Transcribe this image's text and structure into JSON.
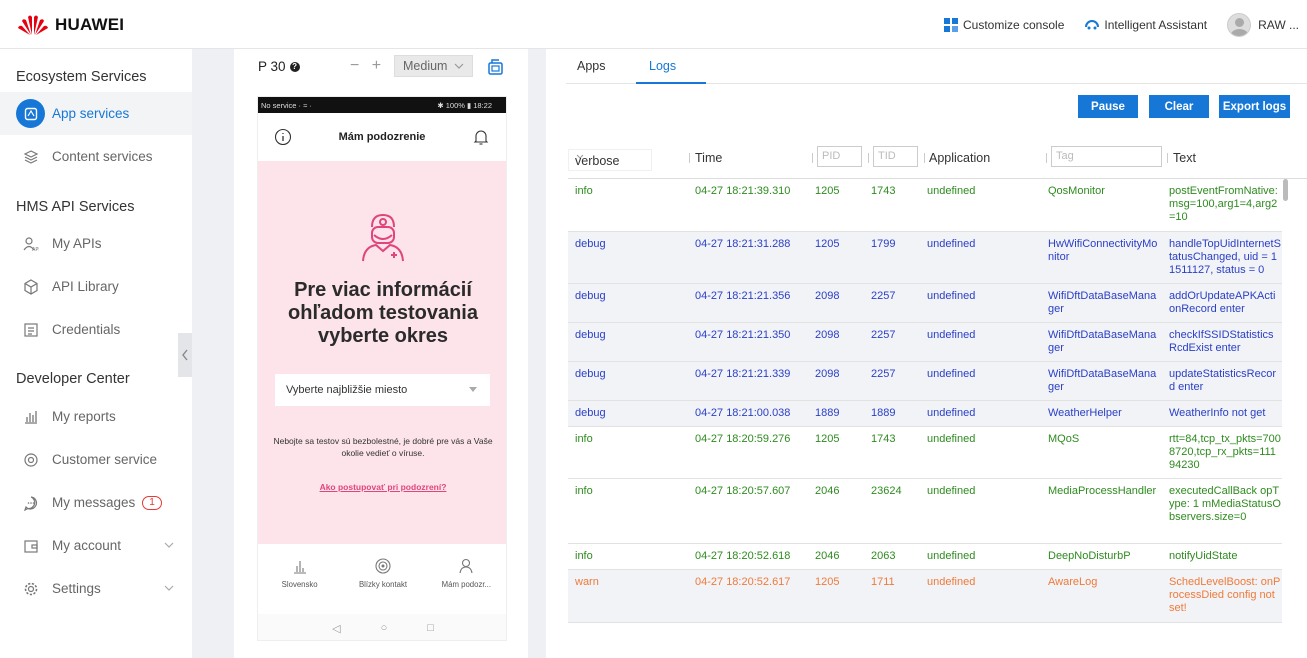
{
  "header": {
    "brand": "HUAWEI",
    "customize_console": "Customize console",
    "intelligent_assistant": "Intelligent Assistant",
    "user_name": "RAW ..."
  },
  "sidebar": {
    "sections": [
      {
        "title": "Ecosystem Services"
      },
      {
        "title": "HMS API Services"
      },
      {
        "title": "Developer Center"
      }
    ],
    "items": [
      {
        "label": "App services",
        "icon": "app-services-icon",
        "active": true
      },
      {
        "label": "Content services",
        "icon": "layers-icon"
      },
      {
        "label": "My APIs",
        "icon": "api-user-icon"
      },
      {
        "label": "API Library",
        "icon": "cube-icon"
      },
      {
        "label": "Credentials",
        "icon": "credentials-icon"
      },
      {
        "label": "My reports",
        "icon": "bar-chart-icon"
      },
      {
        "label": "Customer service",
        "icon": "headset-icon"
      },
      {
        "label": "My messages",
        "icon": "chat-icon",
        "badge": "1"
      },
      {
        "label": "My account",
        "icon": "wallet-icon"
      },
      {
        "label": "Settings",
        "icon": "gear-icon"
      }
    ]
  },
  "device": {
    "name": "P 30",
    "zoom_minus": "−",
    "zoom_plus": "+",
    "size": "Medium",
    "statusbar_left": "No service · ≈ ·",
    "statusbar_right": "✱ 100% ▮ 18:22",
    "app": {
      "title": "Mám podozrenie",
      "hero": "Pre viac informácií ohľadom testovania vyberte okres",
      "select_placeholder": "Vyberte najbližšie miesto",
      "note": "Nebojte sa testov sú bezbolestné, je dobré pre vás a Vaše okolie vedieť o víruse.",
      "link": "Ako postupovať pri podozrení?",
      "tabs": [
        "Slovensko",
        "Blízky kontakt",
        "Mám podozr..."
      ],
      "sys_nav": [
        "◁",
        "○",
        "□"
      ]
    }
  },
  "logs": {
    "tabs": [
      "Apps",
      "Logs"
    ],
    "active_tab": "Logs",
    "buttons": {
      "pause": "Pause",
      "clear": "Clear",
      "export": "Export logs"
    },
    "columns": {
      "level": "verbose",
      "time": "Time",
      "pid_placeholder": "PID",
      "tid_placeholder": "TID",
      "application": "Application",
      "tag_placeholder": "Tag",
      "text": "Text"
    },
    "rows": [
      {
        "level": "info",
        "time": "04-27 18:21:39.310",
        "pid": "1205",
        "tid": "1743",
        "app": "undefined",
        "tag": "QosMonitor",
        "text": "postEventFromNative: msg=100,arg1=4,arg2=10"
      },
      {
        "level": "debug",
        "time": "04-27 18:21:31.288",
        "pid": "1205",
        "tid": "1799",
        "app": "undefined",
        "tag": "HwWifiConnectivityMonitor",
        "text": "handleTopUidInternetStatusChanged, uid = 11511127, status = 0"
      },
      {
        "level": "debug",
        "time": "04-27 18:21:21.356",
        "pid": "2098",
        "tid": "2257",
        "app": "undefined",
        "tag": "WifiDftDataBaseManager",
        "text": "addOrUpdateAPKActionRecord enter"
      },
      {
        "level": "debug",
        "time": "04-27 18:21:21.350",
        "pid": "2098",
        "tid": "2257",
        "app": "undefined",
        "tag": "WifiDftDataBaseManager",
        "text": "checkIfSSIDStatisticsRcdExist enter"
      },
      {
        "level": "debug",
        "time": "04-27 18:21:21.339",
        "pid": "2098",
        "tid": "2257",
        "app": "undefined",
        "tag": "WifiDftDataBaseManager",
        "text": "updateStatisticsRecord enter"
      },
      {
        "level": "debug",
        "time": "04-27 18:21:00.038",
        "pid": "1889",
        "tid": "1889",
        "app": "undefined",
        "tag": "WeatherHelper",
        "text": "WeatherInfo not get"
      },
      {
        "level": "info",
        "time": "04-27 18:20:59.276",
        "pid": "1205",
        "tid": "1743",
        "app": "undefined",
        "tag": "MQoS",
        "text": "rtt=84,tcp_tx_pkts=7008720,tcp_rx_pkts=11194230"
      },
      {
        "level": "info",
        "time": "04-27 18:20:57.607",
        "pid": "2046",
        "tid": "23624",
        "app": "undefined",
        "tag": "MediaProcessHandler",
        "text": "executedCallBack opType: 1 mMediaStatusObservers.size=0"
      },
      {
        "level": "info",
        "time": "04-27 18:20:52.618",
        "pid": "2046",
        "tid": "2063",
        "app": "undefined",
        "tag": "DeepNoDisturbP",
        "text": "notifyUidState"
      },
      {
        "level": "warn",
        "time": "04-27 18:20:52.617",
        "pid": "1205",
        "tid": "1711",
        "app": "undefined",
        "tag": "AwareLog",
        "text": "SchedLevelBoost: onProcessDied config not set!"
      }
    ]
  },
  "colors": {
    "accent": "#1677d7",
    "info": "#2e8b1f",
    "debug": "#2a3fc7",
    "warn": "#f07a3a",
    "pink_bg": "#fce4ea",
    "huawei_red": "#e60012"
  }
}
